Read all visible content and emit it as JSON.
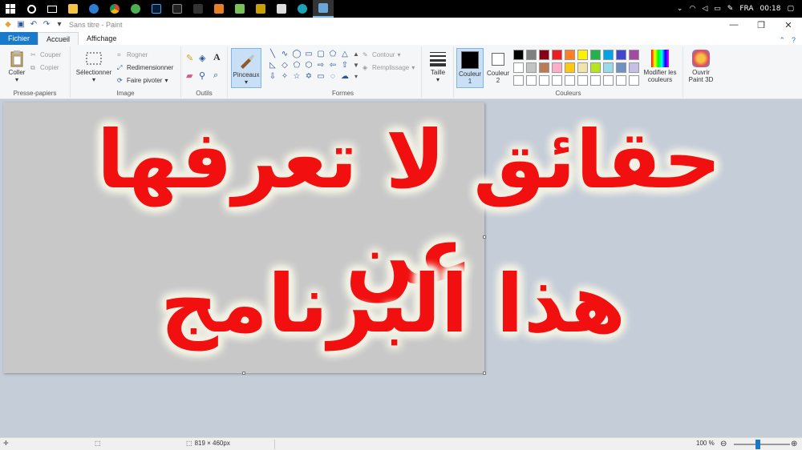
{
  "taskbar": {
    "language": "FRA",
    "time": "00:18"
  },
  "title": "Sans titre - Paint",
  "tabs": [
    "Fichier",
    "Accueil",
    "Affichage"
  ],
  "ribbon": {
    "clipboard": {
      "paste": "Coller",
      "cut": "Couper",
      "copy": "Copier",
      "label": "Presse-papiers"
    },
    "image": {
      "select": "Sélectionner",
      "crop": "Rogner",
      "resize": "Redimensionner",
      "rotate": "Faire pivoter",
      "label": "Image"
    },
    "tools": {
      "label": "Outils"
    },
    "brushes": {
      "label": "Pinceaux"
    },
    "shapes": {
      "outline": "Contour",
      "fill": "Remplissage",
      "label": "Formes"
    },
    "size": {
      "label": "Taille"
    },
    "colors": {
      "color1": "Couleur 1",
      "color2": "Couleur 2",
      "edit": "Modifier les couleurs",
      "label": "Couleurs",
      "palette_row1": [
        "#000000",
        "#7f7f7f",
        "#880015",
        "#ed1c24",
        "#ff7f27",
        "#fff200",
        "#22b14c",
        "#00a2e8",
        "#3f48cc",
        "#a349a4"
      ],
      "palette_row2": [
        "#ffffff",
        "#c3c3c3",
        "#b97a57",
        "#ffaec9",
        "#ffc90e",
        "#efe4b0",
        "#b5e61d",
        "#99d9ea",
        "#7092be",
        "#c8bfe7"
      ]
    },
    "paint3d": "Ouvrir Paint 3D"
  },
  "overlay": {
    "line1": "حقائق لا تعرفها عن",
    "line2": "هذا البرنامج",
    "text_color": "#f10f0f",
    "outline_color": "#f1f0e4"
  },
  "status": {
    "dimensions": "819 × 460px",
    "zoom": "100 %"
  }
}
